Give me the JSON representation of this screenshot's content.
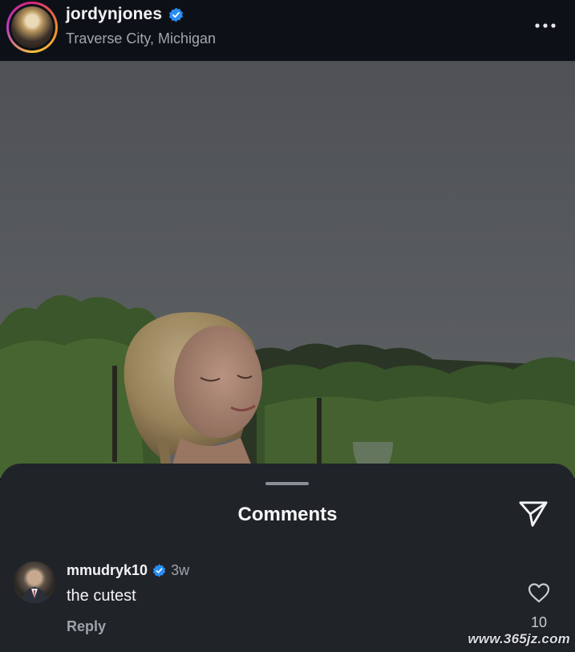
{
  "post": {
    "username": "jordynjones",
    "verified": true,
    "location": "Traverse City, Michigan",
    "more_icon": "more-horizontal-icon"
  },
  "comments_sheet": {
    "title": "Comments",
    "share_icon": "send-icon",
    "comments": [
      {
        "username": "mmudryk10",
        "verified": true,
        "time": "3w",
        "text": "the cutest",
        "reply_label": "Reply",
        "like_icon": "heart-icon",
        "like_count": "10"
      }
    ]
  },
  "watermark": {
    "text": "www.365jz.com"
  },
  "colors": {
    "verified_blue": "#2a8ef5",
    "sheet_bg": "#202429",
    "header_bg": "#0d1117"
  }
}
